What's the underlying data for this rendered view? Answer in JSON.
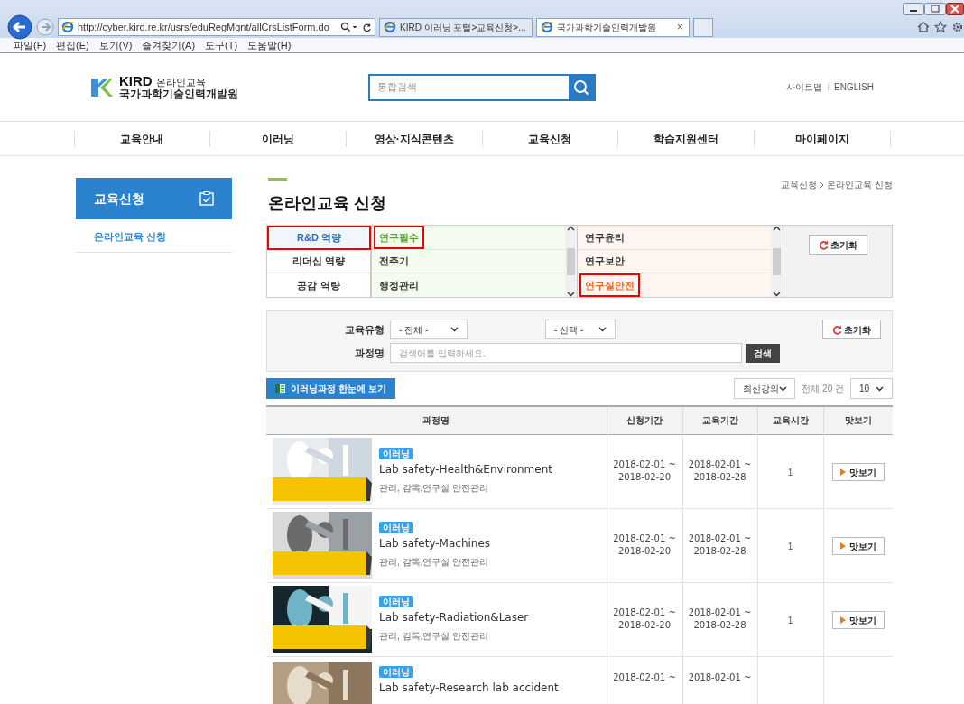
{
  "browser": {
    "address": "http://cyber.kird.re.kr/usrs/eduRegMgnt/allCrsListForm.do",
    "tabs": [
      {
        "title": "KIRD 이러닝 포털>교육신청>...",
        "selected": false
      },
      {
        "title": "국가과학기술인력개발원",
        "selected": true
      }
    ],
    "tab_close": "×",
    "menu": [
      "파일(F)",
      "편집(E)",
      "보기(V)",
      "즐겨찾기(A)",
      "도구(T)",
      "도움말(H)"
    ]
  },
  "header": {
    "logo": {
      "brand": "KIRD",
      "tagline": "온라인교육",
      "org": "국가과학기술인력개발원"
    },
    "search": {
      "placeholder": "통합검색"
    },
    "links": [
      "사이트맵",
      "ENGLISH"
    ]
  },
  "nav": [
    "교육안내",
    "이러닝",
    "영상·지식콘텐츠",
    "교육신청",
    "학습지원센터",
    "마이페이지"
  ],
  "sidebar": {
    "title": "교육신청",
    "items": [
      {
        "label": "온라인교육 신청",
        "selected": true
      }
    ]
  },
  "content": {
    "title": "온라인교육 신청",
    "breadcrumb": [
      "교육신청",
      "온라인교육 신청"
    ],
    "category": {
      "groups": [
        {
          "label": "R&D 역량",
          "selected": true
        },
        {
          "label": "리더십 역량",
          "selected": false
        },
        {
          "label": "공감 역량",
          "selected": false
        }
      ],
      "subcategories": [
        {
          "label": "연구필수",
          "selected": true
        },
        {
          "label": "전주기",
          "selected": false
        },
        {
          "label": "행정관리",
          "selected": false
        }
      ],
      "topics": [
        {
          "label": "연구윤리",
          "selected": false
        },
        {
          "label": "연구보안",
          "selected": false
        },
        {
          "label": "연구실안전",
          "selected": true
        }
      ],
      "reset": "초기화"
    },
    "filters": {
      "type_label": "교육유형",
      "type_value": "- 전체 -",
      "sub_value": "- 선택 -",
      "reset": "초기화",
      "name_label": "과정명",
      "placeholder": "검색어를 입력하세요.",
      "search_button": "검색"
    },
    "toolbar": {
      "excel_button": "이러닝과정 한눈에 보기",
      "sort": "최신강의",
      "total": "전체 20 건",
      "page_size": "10"
    },
    "table": {
      "columns": [
        "과정명",
        "신청기간",
        "교육기간",
        "교육시간",
        "맛보기"
      ],
      "rows": [
        {
          "badge": "이러닝",
          "title": "Lab safety-Health&Environment",
          "desc": "관리, 감독,연구실 안전관리",
          "apply": [
            "2018-02-01 ~",
            "2018-02-20"
          ],
          "period": [
            "2018-02-01 ~",
            "2018-02-28"
          ],
          "hours": "1",
          "preview": "맛보기"
        },
        {
          "badge": "이러닝",
          "title": "Lab safety-Machines",
          "desc": "관리, 감독,연구실 안전관리",
          "apply": [
            "2018-02-01 ~",
            "2018-02-20"
          ],
          "period": [
            "2018-02-01 ~",
            "2018-02-28"
          ],
          "hours": "1",
          "preview": "맛보기"
        },
        {
          "badge": "이러닝",
          "title": "Lab safety-Radiation&Laser",
          "desc": "관리, 감독,연구실 안전관리",
          "apply": [
            "2018-02-01 ~",
            "2018-02-20"
          ],
          "period": [
            "2018-02-01 ~",
            "2018-02-28"
          ],
          "hours": "1",
          "preview": "맛보기"
        },
        {
          "badge": "이러닝",
          "title": "Lab safety-Research lab accident",
          "apply": [
            "2018-02-01 ~"
          ],
          "period": [
            "2018-02-01 ~"
          ]
        }
      ]
    }
  }
}
